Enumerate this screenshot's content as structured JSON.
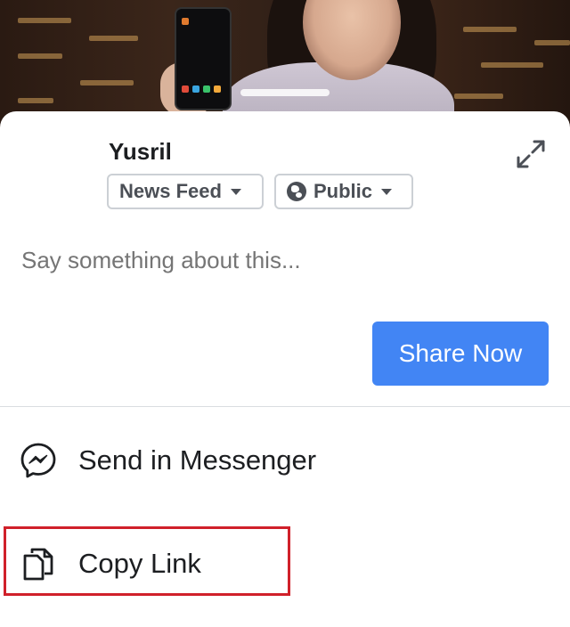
{
  "post": {
    "author_name": "Yusril"
  },
  "audience": {
    "destination_label": "News Feed",
    "privacy_label": "Public"
  },
  "compose": {
    "placeholder": "Say something about this..."
  },
  "actions": {
    "share_now_label": "Share Now",
    "send_messenger_label": "Send in Messenger",
    "copy_link_label": "Copy Link"
  },
  "icons": {
    "expand": "expand-arrows-icon",
    "privacy": "globe-icon",
    "messenger": "messenger-icon",
    "copy": "copy-icon"
  },
  "colors": {
    "accent": "#4285f4",
    "highlight": "#d0202a",
    "text_primary": "#1c1e21",
    "text_muted": "#8d949e"
  }
}
